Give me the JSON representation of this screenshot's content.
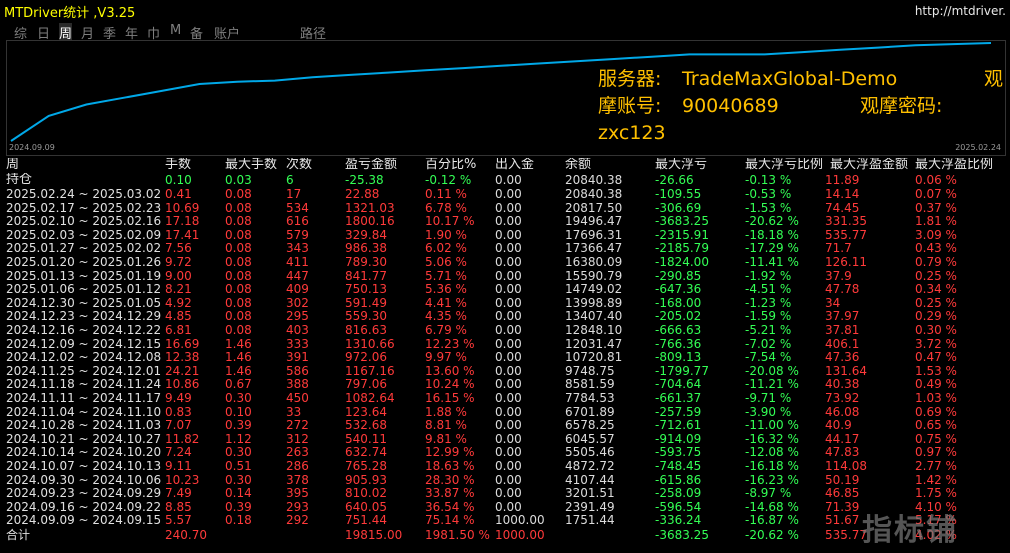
{
  "app": {
    "title": "MTDriver统计  ,V3.25",
    "url": "http://mtdriver."
  },
  "tabs": [
    "综",
    "日",
    "周",
    "月",
    "季",
    "年",
    "巾",
    "M",
    "备",
    "账户",
    "",
    "路径"
  ],
  "active_tab": "周",
  "chart": {
    "x_start": "2024.09.09",
    "x_end": "2025.02.24",
    "line_color": "#00a8e8",
    "series": [
      0,
      11,
      16,
      19,
      22,
      25,
      26,
      26.5,
      28,
      29,
      30,
      31,
      32,
      33,
      34,
      35,
      36,
      37,
      38,
      38,
      38,
      39,
      40,
      41,
      42,
      42.5,
      43
    ]
  },
  "account": {
    "server_label": "服务器:",
    "server": "TradeMaxGlobal-Demo",
    "view_label": "观",
    "account_label": "摩账号:",
    "account": "90040689",
    "pwd_label": "观摩密码:",
    "pwd": "zxc123"
  },
  "headers": [
    "周",
    "手数",
    "最大手数",
    "次数",
    "盈亏金额",
    "百分比%",
    "出入金",
    "余额",
    "最大浮亏",
    "最大浮亏比例",
    "最大浮盈金额",
    "最大浮盈比例"
  ],
  "holding": {
    "label": "持仓",
    "lots": "0.10",
    "maxlots": "0.03",
    "count": "6",
    "pl": "-25.38",
    "pct": "-0.12 %",
    "io": "0.00",
    "bal": "20840.38",
    "maxloss": "-26.66",
    "maxlosspct": "-0.13 %",
    "maxgain": "11.89",
    "maxgainpct": "0.06 %"
  },
  "rows": [
    {
      "period": "2025.02.24 ~ 2025.03.02",
      "lots": "0.41",
      "maxlots": "0.08",
      "count": "17",
      "pl": "22.88",
      "pct": "0.11 %",
      "io": "0.00",
      "bal": "20840.38",
      "maxloss": "-109.55",
      "maxlosspct": "-0.53 %",
      "maxgain": "14.14",
      "maxgainpct": "0.07 %"
    },
    {
      "period": "2025.02.17 ~ 2025.02.23",
      "lots": "10.69",
      "maxlots": "0.08",
      "count": "534",
      "pl": "1321.03",
      "pct": "6.78 %",
      "io": "0.00",
      "bal": "20817.50",
      "maxloss": "-306.69",
      "maxlosspct": "-1.53 %",
      "maxgain": "74.45",
      "maxgainpct": "0.37 %"
    },
    {
      "period": "2025.02.10 ~ 2025.02.16",
      "lots": "17.18",
      "maxlots": "0.08",
      "count": "616",
      "pl": "1800.16",
      "pct": "10.17 %",
      "io": "0.00",
      "bal": "19496.47",
      "maxloss": "-3683.25",
      "maxlosspct": "-20.62 %",
      "maxgain": "331.35",
      "maxgainpct": "1.81 %"
    },
    {
      "period": "2025.02.03 ~ 2025.02.09",
      "lots": "17.41",
      "maxlots": "0.08",
      "count": "579",
      "pl": "329.84",
      "pct": "1.90 %",
      "io": "0.00",
      "bal": "17696.31",
      "maxloss": "-2315.91",
      "maxlosspct": "-18.18 %",
      "maxgain": "535.77",
      "maxgainpct": "3.09 %"
    },
    {
      "period": "2025.01.27 ~ 2025.02.02",
      "lots": "7.56",
      "maxlots": "0.08",
      "count": "343",
      "pl": "986.38",
      "pct": "6.02 %",
      "io": "0.00",
      "bal": "17366.47",
      "maxloss": "-2185.79",
      "maxlosspct": "-17.29 %",
      "maxgain": "71.7",
      "maxgainpct": "0.43 %"
    },
    {
      "period": "2025.01.20 ~ 2025.01.26",
      "lots": "9.72",
      "maxlots": "0.08",
      "count": "411",
      "pl": "789.30",
      "pct": "5.06 %",
      "io": "0.00",
      "bal": "16380.09",
      "maxloss": "-1824.00",
      "maxlosspct": "-11.41 %",
      "maxgain": "126.11",
      "maxgainpct": "0.79 %"
    },
    {
      "period": "2025.01.13 ~ 2025.01.19",
      "lots": "9.00",
      "maxlots": "0.08",
      "count": "447",
      "pl": "841.77",
      "pct": "5.71 %",
      "io": "0.00",
      "bal": "15590.79",
      "maxloss": "-290.85",
      "maxlosspct": "-1.92 %",
      "maxgain": "37.9",
      "maxgainpct": "0.25 %"
    },
    {
      "period": "2025.01.06 ~ 2025.01.12",
      "lots": "8.21",
      "maxlots": "0.08",
      "count": "409",
      "pl": "750.13",
      "pct": "5.36 %",
      "io": "0.00",
      "bal": "14749.02",
      "maxloss": "-647.36",
      "maxlosspct": "-4.51 %",
      "maxgain": "47.78",
      "maxgainpct": "0.34 %"
    },
    {
      "period": "2024.12.30 ~ 2025.01.05",
      "lots": "4.92",
      "maxlots": "0.08",
      "count": "302",
      "pl": "591.49",
      "pct": "4.41 %",
      "io": "0.00",
      "bal": "13998.89",
      "maxloss": "-168.00",
      "maxlosspct": "-1.23 %",
      "maxgain": "34",
      "maxgainpct": "0.25 %"
    },
    {
      "period": "2024.12.23 ~ 2024.12.29",
      "lots": "4.85",
      "maxlots": "0.08",
      "count": "295",
      "pl": "559.30",
      "pct": "4.35 %",
      "io": "0.00",
      "bal": "13407.40",
      "maxloss": "-205.02",
      "maxlosspct": "-1.59 %",
      "maxgain": "37.97",
      "maxgainpct": "0.29 %"
    },
    {
      "period": "2024.12.16 ~ 2024.12.22",
      "lots": "6.81",
      "maxlots": "0.08",
      "count": "403",
      "pl": "816.63",
      "pct": "6.79 %",
      "io": "0.00",
      "bal": "12848.10",
      "maxloss": "-666.63",
      "maxlosspct": "-5.21 %",
      "maxgain": "37.81",
      "maxgainpct": "0.30 %"
    },
    {
      "period": "2024.12.09 ~ 2024.12.15",
      "lots": "16.69",
      "maxlots": "1.46",
      "count": "333",
      "pl": "1310.66",
      "pct": "12.23 %",
      "io": "0.00",
      "bal": "12031.47",
      "maxloss": "-766.36",
      "maxlosspct": "-7.02 %",
      "maxgain": "406.1",
      "maxgainpct": "3.72 %"
    },
    {
      "period": "2024.12.02 ~ 2024.12.08",
      "lots": "12.38",
      "maxlots": "1.46",
      "count": "391",
      "pl": "972.06",
      "pct": "9.97 %",
      "io": "0.00",
      "bal": "10720.81",
      "maxloss": "-809.13",
      "maxlosspct": "-7.54 %",
      "maxgain": "47.36",
      "maxgainpct": "0.47 %"
    },
    {
      "period": "2024.11.25 ~ 2024.12.01",
      "lots": "24.21",
      "maxlots": "1.46",
      "count": "586",
      "pl": "1167.16",
      "pct": "13.60 %",
      "io": "0.00",
      "bal": "9748.75",
      "maxloss": "-1799.77",
      "maxlosspct": "-20.08 %",
      "maxgain": "131.64",
      "maxgainpct": "1.53 %"
    },
    {
      "period": "2024.11.18 ~ 2024.11.24",
      "lots": "10.86",
      "maxlots": "0.67",
      "count": "388",
      "pl": "797.06",
      "pct": "10.24 %",
      "io": "0.00",
      "bal": "8581.59",
      "maxloss": "-704.64",
      "maxlosspct": "-11.21 %",
      "maxgain": "40.38",
      "maxgainpct": "0.49 %"
    },
    {
      "period": "2024.11.11 ~ 2024.11.17",
      "lots": "9.49",
      "maxlots": "0.30",
      "count": "450",
      "pl": "1082.64",
      "pct": "16.15 %",
      "io": "0.00",
      "bal": "7784.53",
      "maxloss": "-661.37",
      "maxlosspct": "-9.71 %",
      "maxgain": "73.92",
      "maxgainpct": "1.03 %"
    },
    {
      "period": "2024.11.04 ~ 2024.11.10",
      "lots": "0.83",
      "maxlots": "0.10",
      "count": "33",
      "pl": "123.64",
      "pct": "1.88 %",
      "io": "0.00",
      "bal": "6701.89",
      "maxloss": "-257.59",
      "maxlosspct": "-3.90 %",
      "maxgain": "46.08",
      "maxgainpct": "0.69 %"
    },
    {
      "period": "2024.10.28 ~ 2024.11.03",
      "lots": "7.07",
      "maxlots": "0.39",
      "count": "272",
      "pl": "532.68",
      "pct": "8.81 %",
      "io": "0.00",
      "bal": "6578.25",
      "maxloss": "-712.61",
      "maxlosspct": "-11.00 %",
      "maxgain": "40.9",
      "maxgainpct": "0.65 %"
    },
    {
      "period": "2024.10.21 ~ 2024.10.27",
      "lots": "11.82",
      "maxlots": "1.12",
      "count": "312",
      "pl": "540.11",
      "pct": "9.81 %",
      "io": "0.00",
      "bal": "6045.57",
      "maxloss": "-914.09",
      "maxlosspct": "-16.32 %",
      "maxgain": "44.17",
      "maxgainpct": "0.75 %"
    },
    {
      "period": "2024.10.14 ~ 2024.10.20",
      "lots": "7.24",
      "maxlots": "0.30",
      "count": "263",
      "pl": "632.74",
      "pct": "12.99 %",
      "io": "0.00",
      "bal": "5505.46",
      "maxloss": "-593.75",
      "maxlosspct": "-12.08 %",
      "maxgain": "47.83",
      "maxgainpct": "0.97 %"
    },
    {
      "period": "2024.10.07 ~ 2024.10.13",
      "lots": "9.11",
      "maxlots": "0.51",
      "count": "286",
      "pl": "765.28",
      "pct": "18.63 %",
      "io": "0.00",
      "bal": "4872.72",
      "maxloss": "-748.45",
      "maxlosspct": "-16.18 %",
      "maxgain": "114.08",
      "maxgainpct": "2.77 %"
    },
    {
      "period": "2024.09.30 ~ 2024.10.06",
      "lots": "10.23",
      "maxlots": "0.30",
      "count": "378",
      "pl": "905.93",
      "pct": "28.30 %",
      "io": "0.00",
      "bal": "4107.44",
      "maxloss": "-615.86",
      "maxlosspct": "-16.23 %",
      "maxgain": "50.19",
      "maxgainpct": "1.42 %"
    },
    {
      "period": "2024.09.23 ~ 2024.09.29",
      "lots": "7.49",
      "maxlots": "0.14",
      "count": "395",
      "pl": "810.02",
      "pct": "33.87 %",
      "io": "0.00",
      "bal": "3201.51",
      "maxloss": "-258.09",
      "maxlosspct": "-8.97 %",
      "maxgain": "46.85",
      "maxgainpct": "1.75 %"
    },
    {
      "period": "2024.09.16 ~ 2024.09.22",
      "lots": "8.85",
      "maxlots": "0.39",
      "count": "293",
      "pl": "640.05",
      "pct": "36.54 %",
      "io": "0.00",
      "bal": "2391.49",
      "maxloss": "-596.54",
      "maxlosspct": "-14.68 %",
      "maxgain": "71.39",
      "maxgainpct": "4.10 %"
    },
    {
      "period": "2024.09.09 ~ 2024.09.15",
      "lots": "5.57",
      "maxlots": "0.18",
      "count": "292",
      "pl": "751.44",
      "pct": "75.14 %",
      "io": "1000.00",
      "bal": "1751.44",
      "maxloss": "-336.24",
      "maxlosspct": "-16.87 %",
      "maxgain": "51.67",
      "maxgainpct": "5.17 %"
    }
  ],
  "total": {
    "label": "合计",
    "lots": "240.70",
    "pl": "19815.00",
    "pct": "1981.50 %",
    "io": "1000.00",
    "maxloss": "-3683.25",
    "maxlosspct": "-20.62 %",
    "maxgain": "535.77",
    "maxgainpct": "4.02 %"
  },
  "watermark": "指标铺"
}
